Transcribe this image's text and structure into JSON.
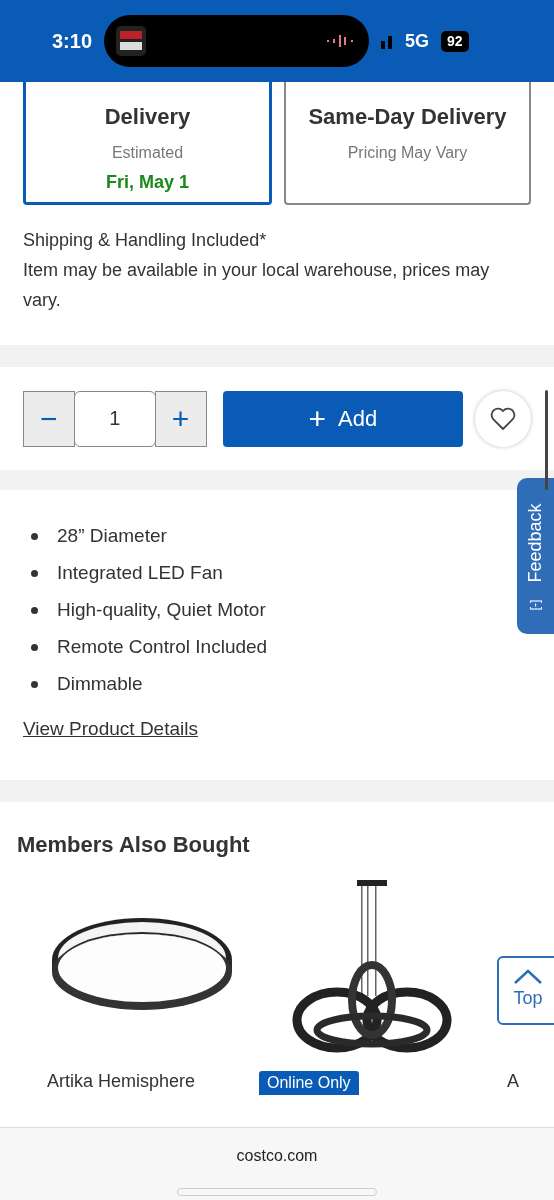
{
  "status_bar": {
    "time": "3:10",
    "network": "5G",
    "battery": "92"
  },
  "delivery_options": [
    {
      "title": "Delivery",
      "subtitle": "Estimated",
      "date": "Fri, May 1",
      "selected": true
    },
    {
      "title": "Same-Day Delivery",
      "subtitle": "Pricing May Vary",
      "selected": false
    }
  ],
  "shipping_note": "Shipping & Handling Included*",
  "warehouse_note": "Item may be available in your local warehouse, prices may vary.",
  "quantity": {
    "value": "1",
    "minus": "−",
    "plus": "+"
  },
  "add_button": {
    "icon": "+",
    "label": "Add"
  },
  "features": [
    "28” Diameter",
    "Integrated LED Fan",
    "High-quality, Quiet Motor",
    "Remote Control Included",
    "Dimmable"
  ],
  "details_link": "View Product Details",
  "feedback_tab": {
    "icon": "[-]",
    "label": "Feedback"
  },
  "members_also_bought": {
    "title": "Members Also Bought",
    "products": [
      {
        "name": "Artika Hemisphere",
        "kind": "flush"
      },
      {
        "badge": "Online Only",
        "kind": "pendant"
      },
      {
        "name": "A",
        "kind": "none"
      }
    ]
  },
  "top_button": {
    "label": "Top"
  },
  "browser_bar": {
    "url": "costco.com"
  }
}
